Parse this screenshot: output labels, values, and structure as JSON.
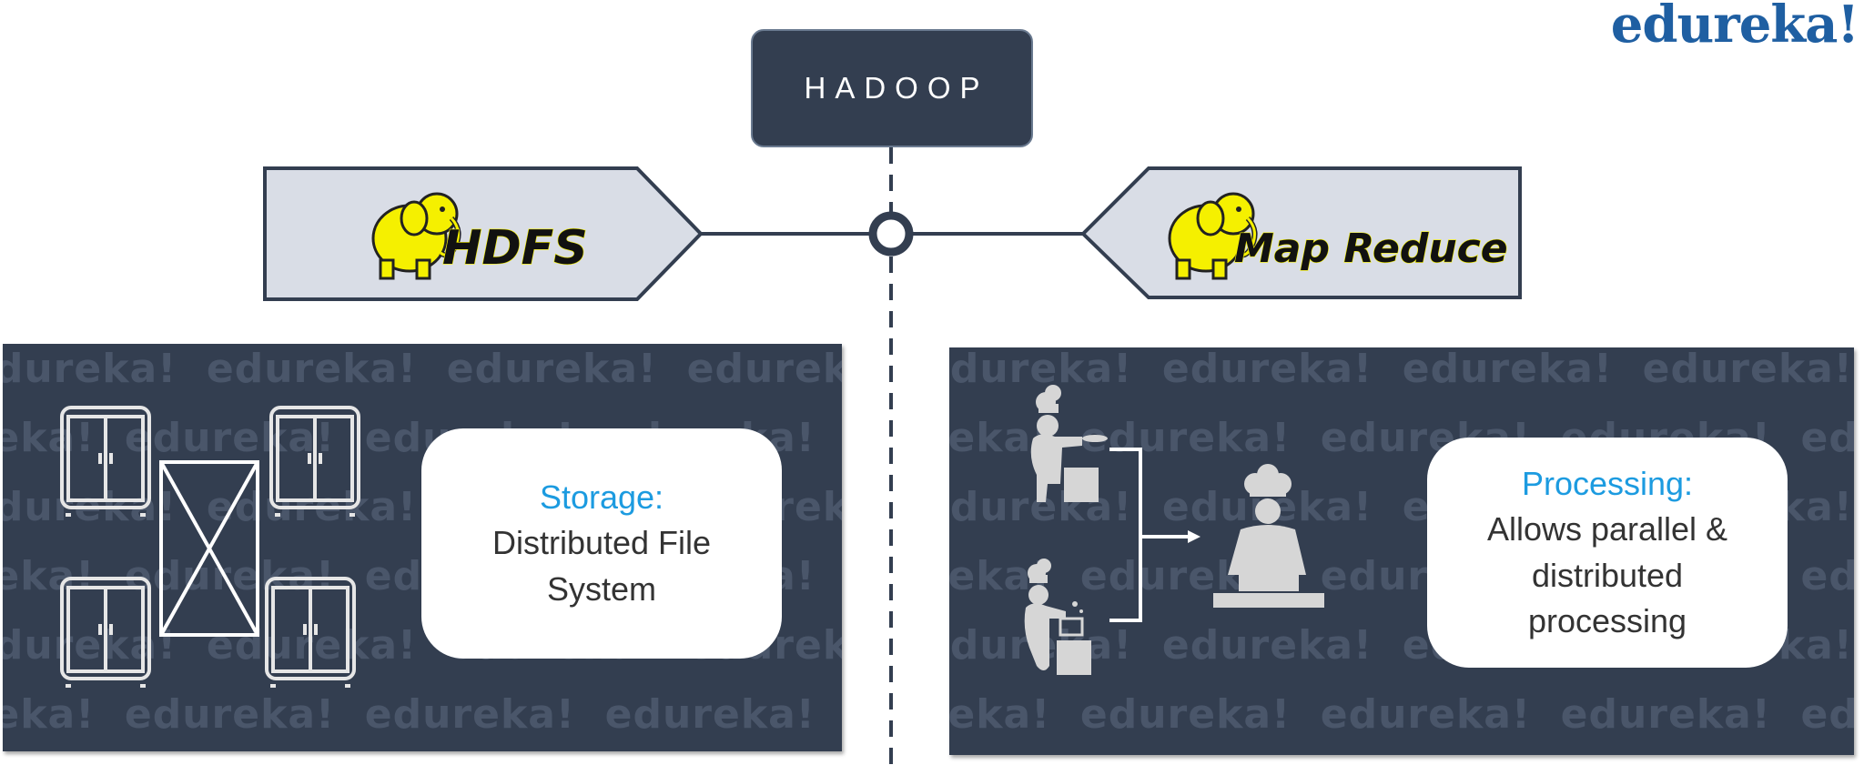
{
  "brand": {
    "logo_text": "edureka!"
  },
  "title": {
    "text": "HADOOP"
  },
  "components": {
    "hdfs": {
      "label": "HDFS",
      "icon": "hadoop-elephant-icon"
    },
    "mapreduce": {
      "label": "Map Reduce",
      "icon": "hadoop-elephant-icon"
    }
  },
  "storage": {
    "heading": "Storage:",
    "body_line1": "Distributed File",
    "body_line2": "System",
    "icons": [
      "cabinet-icon",
      "cabinet-icon",
      "cabinet-icon",
      "cabinet-icon",
      "crossed-box-icon"
    ]
  },
  "processing": {
    "heading": "Processing:",
    "body_line1": "Allows parallel &",
    "body_line2": "distributed",
    "body_line3": "processing",
    "icons": [
      "chef-icon",
      "chef-icon",
      "head-chef-icon",
      "bracket-arrow-icon"
    ]
  },
  "watermark": "edureka!",
  "colors": {
    "panel": "#333e50",
    "watermark": "#4a566a",
    "heading": "#1c9be0",
    "brand": "#1f5fa2",
    "tag_fill": "#d9dde6",
    "connector": "#333e50",
    "elephant": "#f5f000"
  }
}
